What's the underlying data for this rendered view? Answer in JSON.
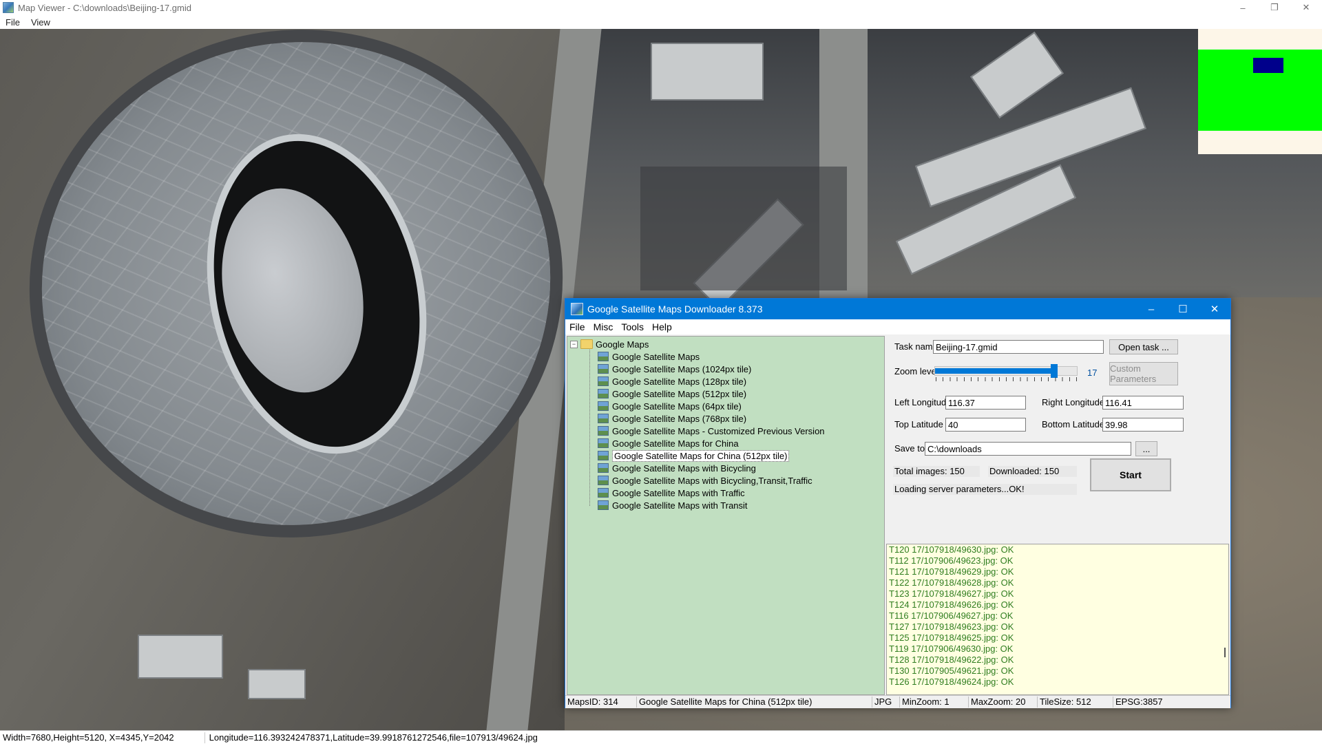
{
  "viewer": {
    "title": "Map Viewer - C:\\downloads\\Beijing-17.gmid",
    "menu": [
      "File",
      "View"
    ],
    "window_buttons": [
      "–",
      "❐",
      "✕"
    ]
  },
  "status": {
    "dims": "Width=7680,Height=5120, X=4345,Y=2042",
    "coords": "Longitude=116.393242478371,Latitude=39.9918761272546,file=107913/49624.jpg"
  },
  "dialog": {
    "title": "Google Satellite Maps Downloader 8.373",
    "menu": [
      "File",
      "Misc",
      "Tools",
      "Help"
    ],
    "window_buttons": [
      "–",
      "☐",
      "✕"
    ],
    "tree": {
      "root": "Google Maps",
      "items": [
        "Google Satellite Maps",
        "Google Satellite Maps (1024px tile)",
        "Google Satellite Maps (128px tile)",
        "Google Satellite Maps (512px tile)",
        "Google Satellite Maps (64px tile)",
        "Google Satellite Maps (768px tile)",
        "Google Satellite Maps - Customized Previous Version",
        "Google Satellite Maps for China",
        "Google Satellite Maps for China (512px tile)",
        "Google Satellite Maps with Bicycling",
        "Google Satellite Maps with Bicycling,Transit,Traffic",
        "Google Satellite Maps with Traffic",
        "Google Satellite Maps with Transit"
      ],
      "selected_index": 8
    },
    "form": {
      "task_name_label": "Task name",
      "task_name": "Beijing-17.gmid",
      "open_task": "Open task ...",
      "zoom_label": "Zoom level",
      "zoom_value": "17",
      "zoom_level": 17,
      "zoom_max": 20,
      "custom_params": "Custom Parameters",
      "left_lon_label": "Left Longitude",
      "left_lon": "116.37",
      "right_lon_label": "Right Longitude",
      "right_lon": "116.41",
      "top_lat_label": "Top Latitude",
      "top_lat": "40",
      "bottom_lat_label": "Bottom Latitude",
      "bottom_lat": "39.98",
      "save_to_label": "Save to",
      "save_to": "C:\\downloads",
      "browse": "...",
      "total_images": "Total images: 150",
      "downloaded": "Downloaded: 150",
      "start": "Start",
      "server_status": "Loading server parameters...OK!"
    },
    "log": [
      "T120 17/107918/49630.jpg: OK",
      "T112 17/107906/49623.jpg: OK",
      "T121 17/107918/49629.jpg: OK",
      "T122 17/107918/49628.jpg: OK",
      "T123 17/107918/49627.jpg: OK",
      "T124 17/107918/49626.jpg: OK",
      "T116 17/107906/49627.jpg: OK",
      "T127 17/107918/49623.jpg: OK",
      "T125 17/107918/49625.jpg: OK",
      "T119 17/107906/49630.jpg: OK",
      "T128 17/107918/49622.jpg: OK",
      "T130 17/107905/49621.jpg: OK",
      "T126 17/107918/49624.jpg: OK"
    ],
    "statusbar": {
      "maps_id": "MapsID: 314",
      "map_name": "Google Satellite Maps for China (512px tile)",
      "format": "JPG",
      "min_zoom": "MinZoom: 1",
      "max_zoom": "MaxZoom: 20",
      "tile_size": "TileSize: 512",
      "epsg": "EPSG:3857"
    }
  },
  "colors": {
    "dialog_title": "#0078d7",
    "tree_bg": "#c1dfc1",
    "log_bg": "#ffffe1",
    "log_text": "#2f7d1f",
    "minimap_frame": "#00ff00",
    "minimap_viewport": "#00008b"
  }
}
